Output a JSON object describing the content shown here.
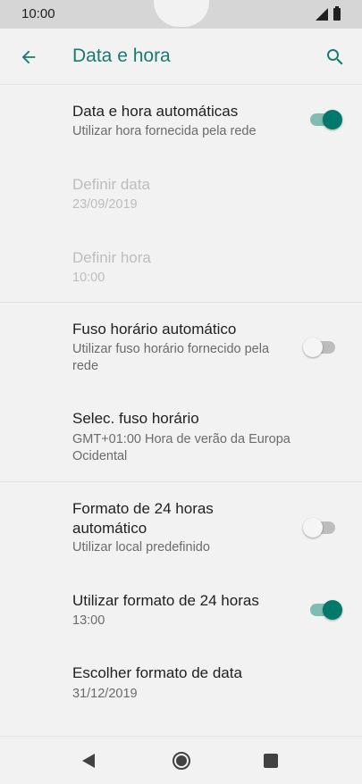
{
  "status_bar": {
    "time": "10:00"
  },
  "app_bar": {
    "title": "Data e hora"
  },
  "settings": {
    "auto_datetime": {
      "title": "Data e hora automáticas",
      "subtitle": "Utilizar hora fornecida pela rede",
      "enabled": true
    },
    "set_date": {
      "title": "Definir data",
      "value": "23/09/2019"
    },
    "set_time": {
      "title": "Definir hora",
      "value": "10:00"
    },
    "auto_timezone": {
      "title": "Fuso horário automático",
      "subtitle": "Utilizar fuso horário fornecido pela rede",
      "enabled": false
    },
    "select_timezone": {
      "title": "Selec. fuso horário",
      "value": "GMT+01:00 Hora de verão da Europa Ocidental"
    },
    "auto_24h": {
      "title": "Formato de 24 horas automático",
      "subtitle": "Utilizar local predefinido",
      "enabled": false
    },
    "use_24h": {
      "title": "Utilizar formato de 24 horas",
      "value": "13:00",
      "enabled": true
    },
    "date_format": {
      "title": "Escolher formato de data",
      "value": "31/12/2019"
    }
  },
  "colors": {
    "accent": "#00796b",
    "title": "#1a7a6e"
  },
  "icons": {
    "back": "arrow-left-icon",
    "search": "search-icon"
  }
}
